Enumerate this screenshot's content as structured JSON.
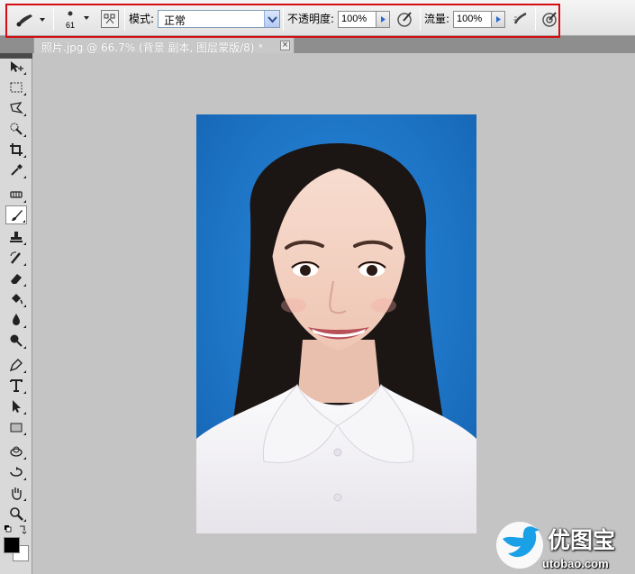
{
  "options_bar": {
    "brush_size": "61",
    "mode_label": "模式:",
    "mode_value": "正常",
    "opacity_label": "不透明度:",
    "opacity_value": "100%",
    "flow_label": "流量:",
    "flow_value": "100%",
    "highlight_color": "#d40d12"
  },
  "document_tab": {
    "title": "照片.jpg @ 66.7% (背景 副本, 图层蒙版/8) *",
    "close_glyph": "×"
  },
  "tools": [
    "move-icon",
    "marquee-icon",
    "lasso-icon",
    "quick-selection-icon",
    "crop-icon",
    "eyedropper-icon",
    "healing-brush-icon",
    "brush-icon",
    "clone-stamp-icon",
    "history-brush-icon",
    "eraser-icon",
    "paint-bucket-icon",
    "blur-icon",
    "dodge-icon",
    "pen-icon",
    "type-icon",
    "path-selection-icon",
    "rectangle-icon",
    "3d-rotate-icon",
    "3d-orbit-icon",
    "hand-icon",
    "zoom-icon"
  ],
  "colors": {
    "foreground": "#000000",
    "background": "#ffffff",
    "photo_backdrop": "#1f7ac8",
    "workspace": "#c4c4c4"
  },
  "watermark": {
    "cn": "优图宝",
    "en": "utobao.com"
  }
}
